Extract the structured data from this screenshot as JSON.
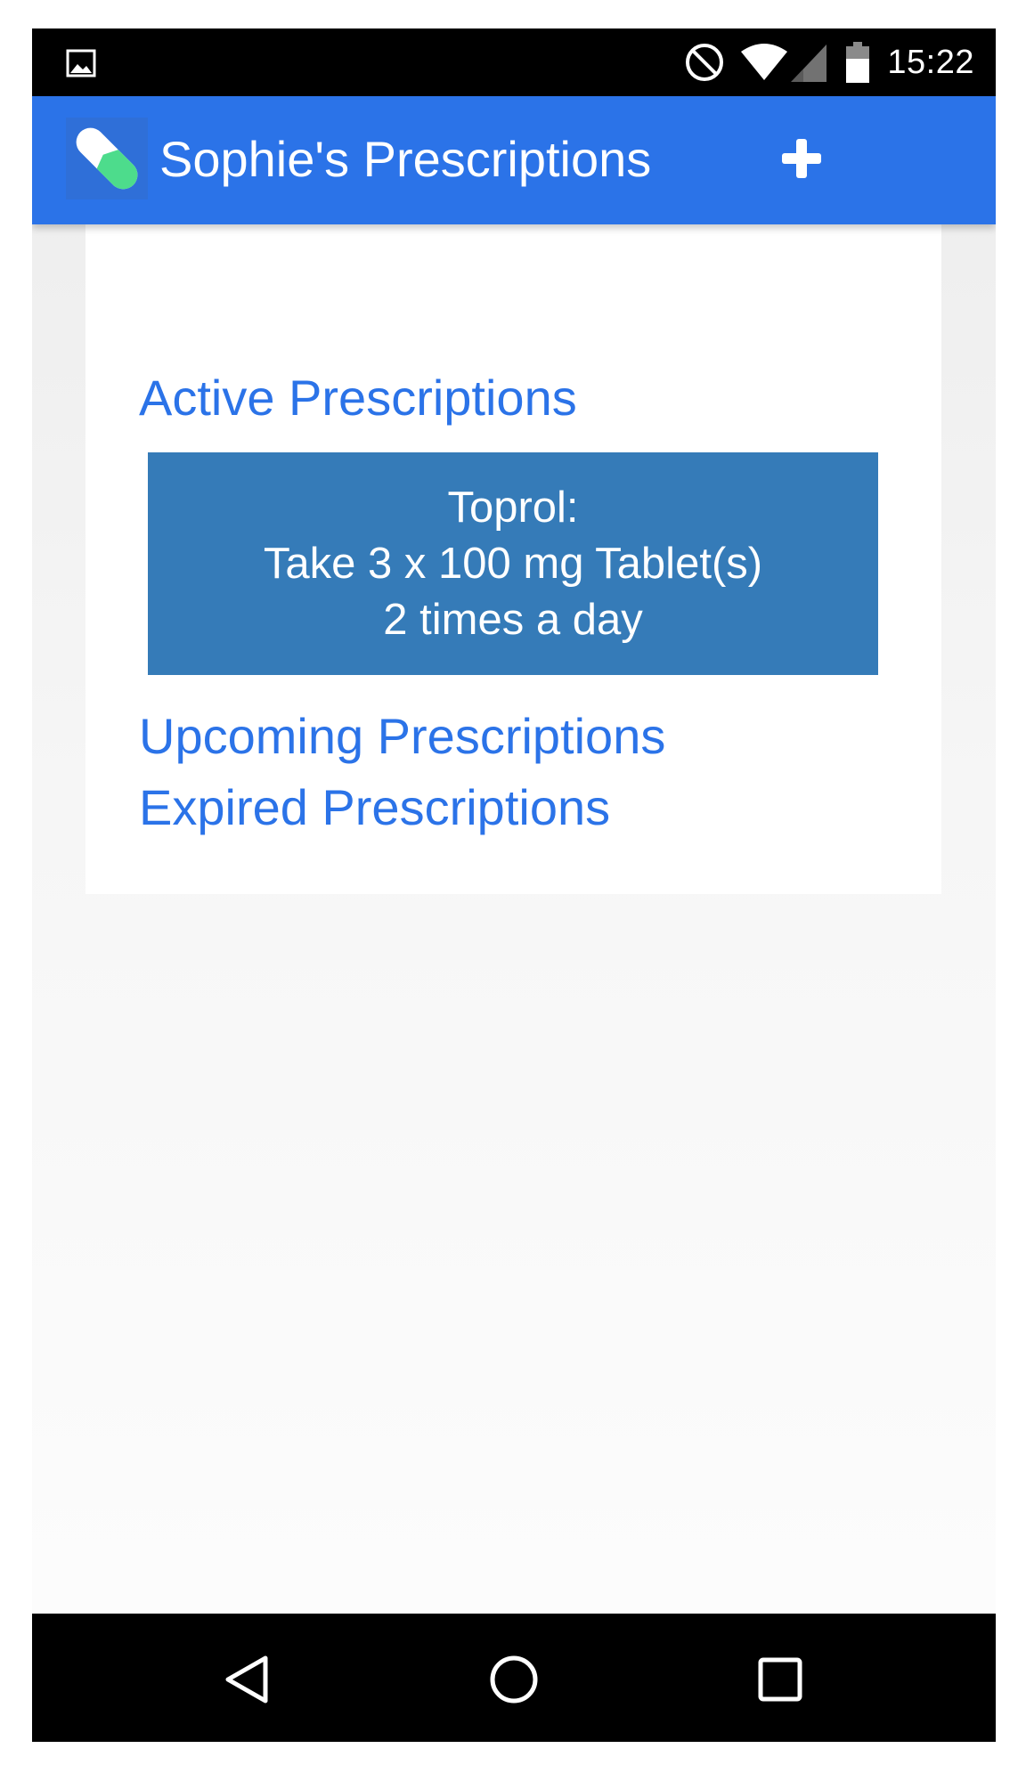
{
  "status_bar": {
    "time": "15:22",
    "icons": [
      "image-icon",
      "do-not-disturb-icon",
      "wifi-icon",
      "signal-icon",
      "battery-icon"
    ]
  },
  "app_bar": {
    "title": "Sophie's Prescriptions",
    "logo_icon": "pill-capsule-icon",
    "add_icon": "plus-icon",
    "background_color": "#2b73e8"
  },
  "sections": {
    "active": {
      "label": "Active Prescriptions",
      "items": [
        {
          "name": "Toprol:",
          "dosage": "Take 3 x 100 mg Tablet(s)",
          "frequency": "2 times a day"
        }
      ]
    },
    "upcoming": {
      "label": "Upcoming Prescriptions"
    },
    "expired": {
      "label": "Expired Prescriptions"
    }
  },
  "colors": {
    "link": "#2b73e8",
    "item_background": "#357bb8",
    "logo_green": "#4ddc8c"
  },
  "nav_bar": {
    "icons": [
      "back-icon",
      "home-icon",
      "recents-icon"
    ]
  }
}
